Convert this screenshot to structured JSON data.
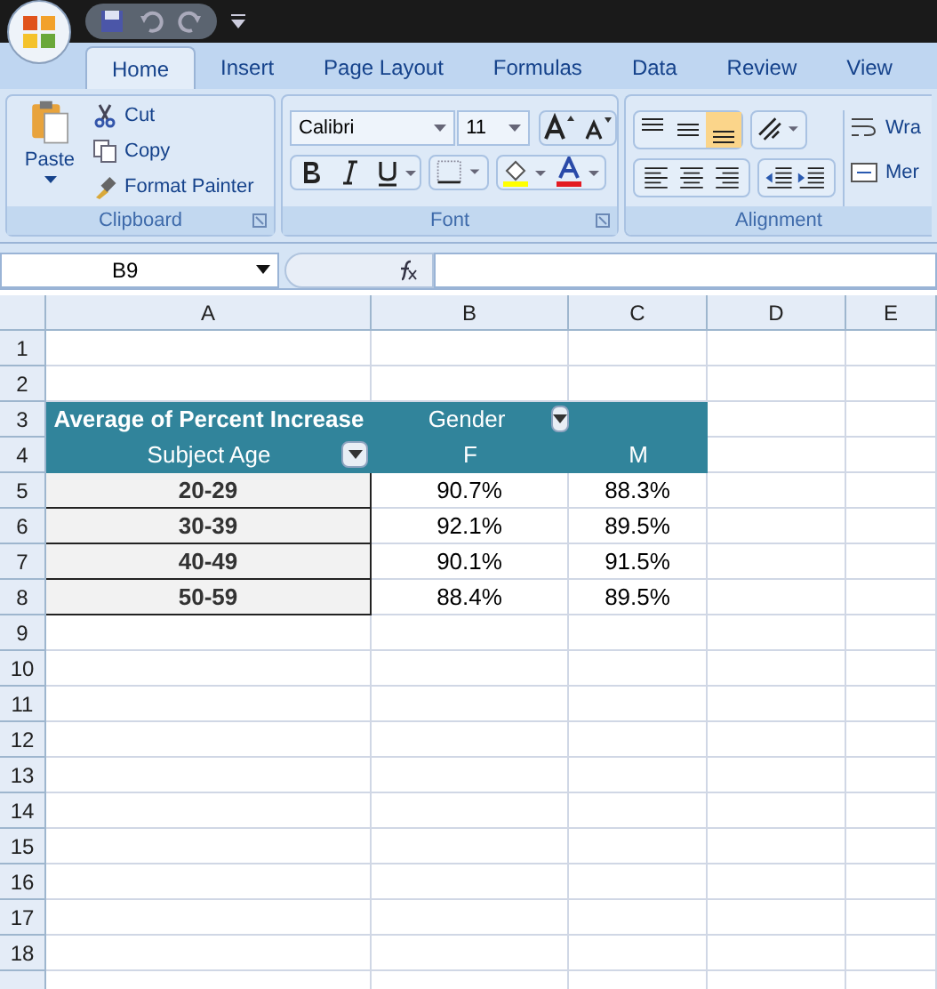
{
  "ribbon_tabs": [
    {
      "label": "Home",
      "selected": true
    },
    {
      "label": "Insert",
      "selected": false
    },
    {
      "label": "Page Layout",
      "selected": false
    },
    {
      "label": "Formulas",
      "selected": false
    },
    {
      "label": "Data",
      "selected": false
    },
    {
      "label": "Review",
      "selected": false
    },
    {
      "label": "View",
      "selected": false
    }
  ],
  "clipboard": {
    "paste": "Paste",
    "cut": "Cut",
    "copy": "Copy",
    "format_painter": "Format Painter",
    "label": "Clipboard"
  },
  "font": {
    "font_name": "Calibri",
    "font_size": "11",
    "label": "Font"
  },
  "alignment": {
    "vertical_buttons": [
      {
        "kind": "top",
        "selected": false
      },
      {
        "kind": "middle",
        "selected": false
      },
      {
        "kind": "bottom",
        "selected": true
      }
    ],
    "wrap_text": "Wra",
    "merge": "Mer",
    "label": "Alignment"
  },
  "formula_bar": {
    "name_box": "B9"
  },
  "columns": [
    "A",
    "B",
    "C",
    "D",
    "E"
  ],
  "row_numbers": [
    "1",
    "2",
    "3",
    "4",
    "5",
    "6",
    "7",
    "8",
    "9",
    "10",
    "11",
    "12",
    "13",
    "14",
    "15",
    "16",
    "17",
    "18"
  ],
  "pivot": {
    "data_field": "Average of Percent Increase",
    "column_field": "Gender",
    "row_field": "Subject Age",
    "column_items": [
      "F",
      "M"
    ],
    "rows": [
      {
        "label": "20-29",
        "values": [
          "90.7%",
          "88.3%"
        ]
      },
      {
        "label": "30-39",
        "values": [
          "92.1%",
          "89.5%"
        ]
      },
      {
        "label": "40-49",
        "values": [
          "90.1%",
          "91.5%"
        ]
      },
      {
        "label": "50-59",
        "values": [
          "88.4%",
          "89.5%"
        ]
      }
    ]
  }
}
